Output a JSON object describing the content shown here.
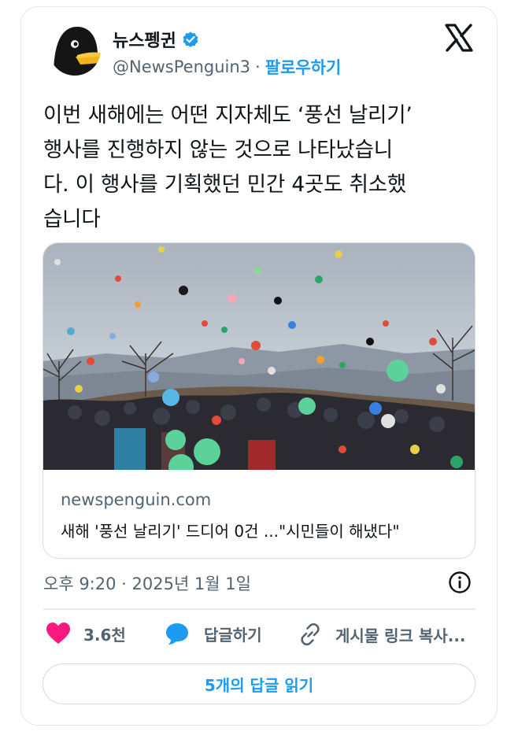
{
  "author": {
    "name": "뉴스펭귄",
    "handle": "@NewsPenguin3",
    "separator": "·",
    "follow_label": "팔로우하기"
  },
  "tweet": {
    "lines": [
      "이번 새해에는 어떤 지자체도 ‘풍선 날리기’",
      "행사를 진행하지 않는 것으로 나타났습니",
      "다. 이 행사를 기획했던 민간 4곳도 취소했",
      "습니다"
    ]
  },
  "link_card": {
    "domain": "newspenguin.com",
    "headline": "새해 '풍선 날리기' 드디어 0건 ...\"시민들이 해냈다\""
  },
  "timestamp": "오후 9:20 · 2025년 1월 1일",
  "actions": {
    "like_count": "3.6천",
    "reply_label": "답글하기",
    "copy_label": "게시물 링크 복사..."
  },
  "read_replies_label": "5개의 답글 읽기",
  "colors": {
    "accent": "#1d9bf0",
    "like": "#f91880",
    "text": "#0f1419",
    "muted": "#536471"
  },
  "icons": [
    "penguin-avatar",
    "verified-badge-icon",
    "x-logo-icon",
    "info-icon",
    "heart-icon",
    "reply-bubble-icon",
    "link-icon"
  ]
}
